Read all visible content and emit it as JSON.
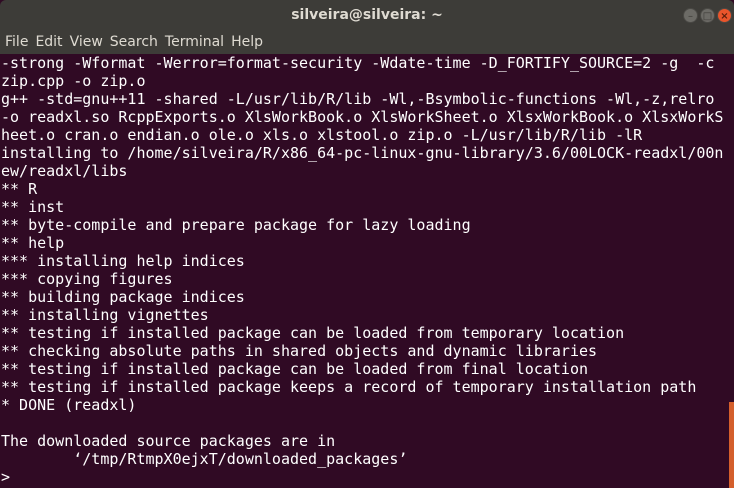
{
  "window": {
    "title": "silveira@silveira: ~",
    "buttons": {
      "minimize": "–",
      "maximize": "□",
      "close": "×"
    }
  },
  "menu": [
    "File",
    "Edit",
    "View",
    "Search",
    "Terminal",
    "Help"
  ],
  "terminal": {
    "lines": [
      "-strong -Wformat -Werror=format-security -Wdate-time -D_FORTIFY_SOURCE=2 -g  -c",
      "zip.cpp -o zip.o",
      "g++ -std=gnu++11 -shared -L/usr/lib/R/lib -Wl,-Bsymbolic-functions -Wl,-z,relro",
      "-o readxl.so RcppExports.o XlsWorkBook.o XlsWorkSheet.o XlsxWorkBook.o XlsxWorkS",
      "heet.o cran.o endian.o ole.o xls.o xlstool.o zip.o -L/usr/lib/R/lib -lR",
      "installing to /home/silveira/R/x86_64-pc-linux-gnu-library/3.6/00LOCK-readxl/00n",
      "ew/readxl/libs",
      "** R",
      "** inst",
      "** byte-compile and prepare package for lazy loading",
      "** help",
      "*** installing help indices",
      "*** copying figures",
      "** building package indices",
      "** installing vignettes",
      "** testing if installed package can be loaded from temporary location",
      "** checking absolute paths in shared objects and dynamic libraries",
      "** testing if installed package can be loaded from final location",
      "** testing if installed package keeps a record of temporary installation path",
      "* DONE (readxl)",
      "",
      "The downloaded source packages are in",
      "        ‘/tmp/RtmpX0ejxT/downloaded_packages’",
      ">"
    ]
  },
  "colors": {
    "background": "#300a24",
    "scrollbar": "#d45f2c",
    "titlebar": "#3d3c38"
  }
}
